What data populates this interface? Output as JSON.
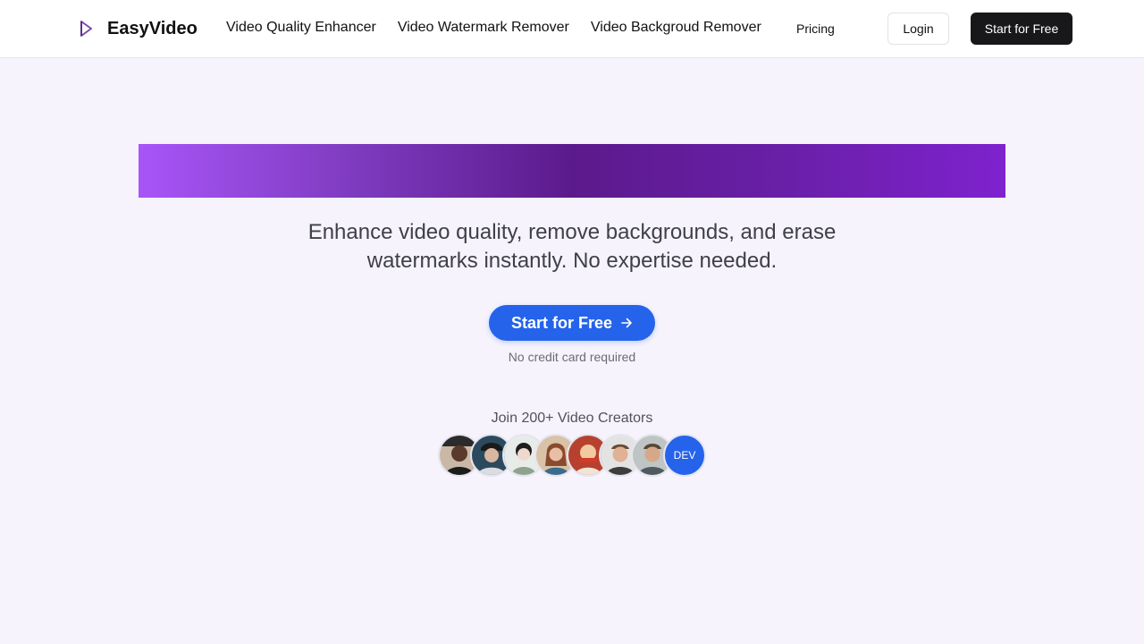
{
  "header": {
    "logo_icon": "play-triangle-icon",
    "brand": "EasyVideo",
    "nav": [
      {
        "label": "Video Quality Enhancer"
      },
      {
        "label": "Video Watermark Remover"
      },
      {
        "label": "Video Backgroud Remover"
      }
    ],
    "pricing": "Pricing",
    "login": "Login",
    "start_free": "Start for Free"
  },
  "hero": {
    "subtitle": "Enhance video quality, remove backgrounds, and erase watermarks instantly. No expertise needed.",
    "cta_label": "Start for Free",
    "cta_icon": "arrow-right-icon",
    "note": "No credit card required"
  },
  "social": {
    "join_text": "Join 200+ Video Creators",
    "avatars": [
      {
        "type": "photo"
      },
      {
        "type": "photo"
      },
      {
        "type": "photo"
      },
      {
        "type": "photo"
      },
      {
        "type": "photo"
      },
      {
        "type": "photo"
      },
      {
        "type": "photo"
      },
      {
        "type": "badge",
        "label": "DEV"
      }
    ]
  },
  "colors": {
    "accent": "#2563eb",
    "dark_button": "#18181b",
    "background": "#f6f3fd",
    "banner_gradient": [
      "#a855f7",
      "#5b1a8c",
      "#7e22ce"
    ]
  }
}
